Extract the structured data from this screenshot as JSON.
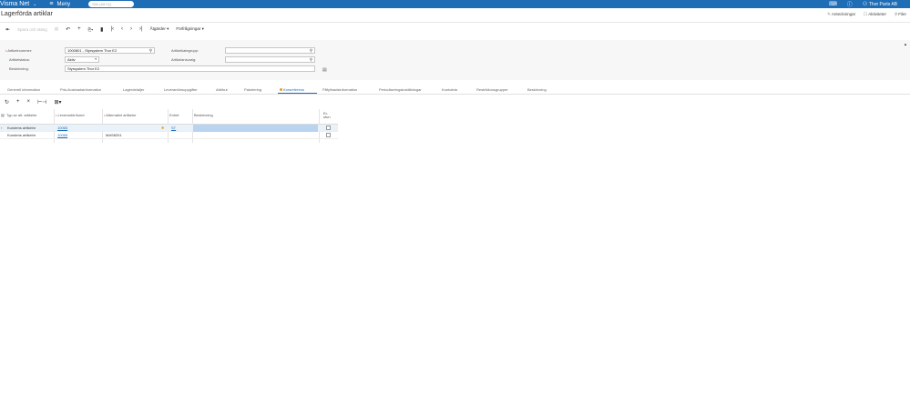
{
  "topbar": {
    "brand": "Visma Net",
    "brand_chevron": "⌄",
    "menu_icon": "hamburger-icon",
    "menu_label": "Meny",
    "search_placeholder": "Sök (Alt+Q)",
    "user_name": "Thor Parts AB"
  },
  "page": {
    "title": "Lagerförda artiklar",
    "links": [
      {
        "icon": "✎",
        "label": "Anteckningar"
      },
      {
        "icon": "☐",
        "label": "Aktiviteter"
      },
      {
        "icon": "⚲",
        "label": "Filer"
      }
    ]
  },
  "toolbar": {
    "save_close": "Spara och stäng",
    "actions": "Åtgärder",
    "queries": "Förfrågningar"
  },
  "form": {
    "item_number_label": "Artikelnummer:",
    "item_number_value": "1000801 - Styrsystem Thor E2",
    "item_status_label": "Artikelstatus:",
    "item_status_value": "Aktiv",
    "description_label": "Beskrivning:",
    "description_value": "Styrsystem Thor E2",
    "item_class_label": "Artikelkategrupp:",
    "item_class_value": "",
    "lot_label": "Artikelansvarig:",
    "lot_value": ""
  },
  "tabs": [
    "Generell information",
    "Pris-/kostnadsinformation",
    "Lagerdetaljer",
    "Leverantörsuppgifter",
    "Attribut",
    "Paketering",
    "Korsreferens",
    "Påfyllnadsinformation",
    "Periodiseringsinställningar",
    "Kontoleta",
    "Restriktionsgrupper",
    "Beskrivning"
  ],
  "active_tab_index": 6,
  "grid": {
    "headers": {
      "type": "Typ av alt. artikelnr",
      "vendor": "Leverantör/kund",
      "alt_item": "Alternativt artikelnr",
      "unit": "Enhet",
      "description": "Beskrivning",
      "expired_line1": "Er-",
      "expired_line2": "stun"
    },
    "rows": [
      {
        "type": "Kundens artikelnr",
        "vendor": "10065",
        "alt_item": "",
        "unit": "ST",
        "description": ""
      },
      {
        "type": "Kundens artikelnr",
        "vendor": "10065",
        "alt_item": "MAS8201",
        "unit": "",
        "description": ""
      }
    ]
  }
}
